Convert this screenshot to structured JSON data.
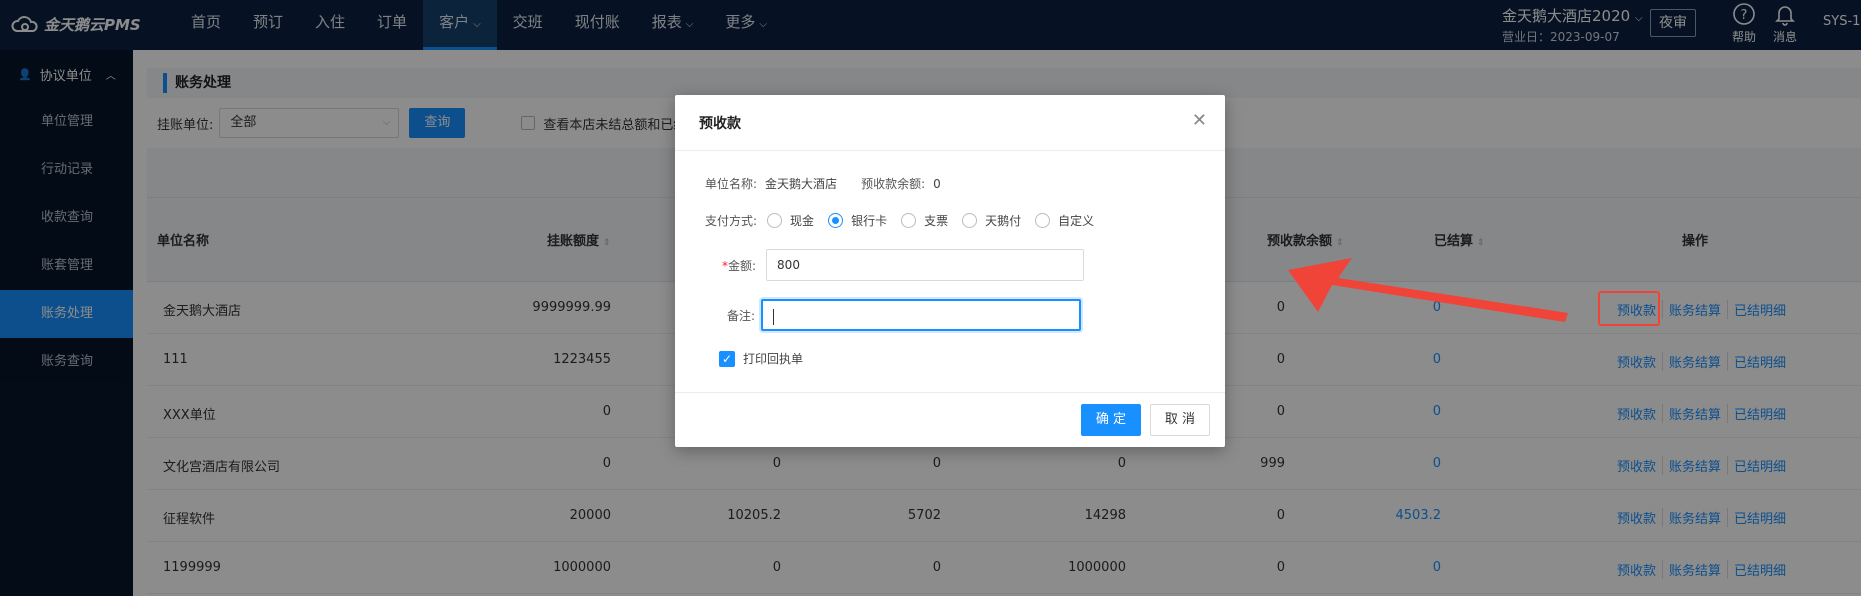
{
  "app": {
    "logo_text": "金天鹅云PMS"
  },
  "nav": {
    "items": [
      {
        "label": "首页",
        "dropdown": false
      },
      {
        "label": "预订",
        "dropdown": false
      },
      {
        "label": "入住",
        "dropdown": false
      },
      {
        "label": "订单",
        "dropdown": false
      },
      {
        "label": "客户",
        "dropdown": true,
        "active": true
      },
      {
        "label": "交班",
        "dropdown": false
      },
      {
        "label": "现付账",
        "dropdown": false
      },
      {
        "label": "报表",
        "dropdown": true
      },
      {
        "label": "更多",
        "dropdown": true
      }
    ],
    "hotel_name": "金天鹅大酒店2020",
    "business_date": "营业日：2023-09-07",
    "night_audit": "夜审",
    "help": "帮助",
    "messages": "消息",
    "user": "SYS-1"
  },
  "sidebar": {
    "group": "协议单位",
    "items": [
      {
        "label": "单位管理"
      },
      {
        "label": "行动记录"
      },
      {
        "label": "收款查询"
      },
      {
        "label": "账套管理"
      },
      {
        "label": "账务处理",
        "active": true
      },
      {
        "label": "账务查询"
      }
    ]
  },
  "main": {
    "section_title": "账务处理",
    "filter": {
      "unit_label": "挂账单位:",
      "unit_value": "全部",
      "query": "查询",
      "checkbox_label": "查看本店未结总额和已结算"
    },
    "table": {
      "headers": {
        "name": "单位名称",
        "credit": "挂账额度",
        "prepaid_balance": "预收款余额",
        "settled": "已结算",
        "ops": "操作"
      },
      "rows": [
        {
          "name": "金天鹅大酒店",
          "credit": "9999999.99",
          "c1": "",
          "c2": "",
          "c3": "",
          "prepaid": "0",
          "settled": "0"
        },
        {
          "name": "111",
          "credit": "1223455",
          "c1": "",
          "c2": "",
          "c3": "",
          "prepaid": "0",
          "settled": "0"
        },
        {
          "name": "XXX单位",
          "credit": "0",
          "c1": "",
          "c2": "",
          "c3": "",
          "prepaid": "0",
          "settled": "0"
        },
        {
          "name": "文化宫酒店有限公司",
          "credit": "0",
          "c1": "0",
          "c2": "0",
          "c3": "0",
          "prepaid": "999",
          "settled": "0"
        },
        {
          "name": "征程软件",
          "credit": "20000",
          "c1": "10205.2",
          "c2": "5702",
          "c3": "14298",
          "prepaid": "0",
          "settled": "4503.2"
        },
        {
          "name": "1199999",
          "credit": "1000000",
          "c1": "0",
          "c2": "0",
          "c3": "1000000",
          "prepaid": "0",
          "settled": "0"
        }
      ],
      "op_labels": {
        "prepay": "预收款",
        "settle": "账务结算",
        "detail": "已结明细"
      }
    }
  },
  "modal": {
    "title": "预收款",
    "unit_name_label": "单位名称:",
    "unit_name_value": "金天鹅大酒店",
    "balance_label": "预收款余额:",
    "balance_value": "0",
    "pay_method_label": "支付方式:",
    "pay_methods": [
      {
        "label": "现金",
        "selected": false
      },
      {
        "label": "银行卡",
        "selected": true
      },
      {
        "label": "支票",
        "selected": false
      },
      {
        "label": "天鹅付",
        "selected": false
      },
      {
        "label": "自定义",
        "selected": false
      }
    ],
    "amount_label": "金额:",
    "amount_value": "800",
    "remark_label": "备注:",
    "remark_value": "",
    "print_receipt": "打印回执单",
    "ok": "确 定",
    "cancel": "取 消"
  },
  "colors": {
    "nav_bg": "#0b2240",
    "sidebar_bg": "#061529",
    "accent": "#1890ff",
    "annotation": "#f04438"
  }
}
